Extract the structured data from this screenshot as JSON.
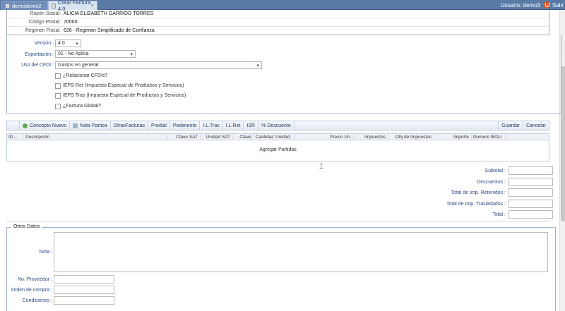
{
  "tabs": [
    {
      "label": "demodemo2"
    },
    {
      "label": "Crear Factura 4.0",
      "close": "×"
    }
  ],
  "user": {
    "label": "Usuario: demo3",
    "logout": "Salir"
  },
  "emisor": {
    "razon_social_label": "Razón Social:",
    "razon_social": "ALICIA ELIZABETH GARRIDO TORRES",
    "codigo_postal_label": "Código Postal:",
    "codigo_postal": "70000",
    "regimen_label": "Regimen Fiscal:",
    "regimen": "626 - Regimen Simplificado de Confianza"
  },
  "form": {
    "version_label": "Versión :",
    "version_value": "4.0",
    "exportacion_label": "Exportación :",
    "exportacion_value": "01 - No Aplica",
    "uso_cfdi_label": "Uso del CFDI :",
    "uso_cfdi_value": "Gastos en general",
    "checks": [
      "¿Relacionar CFDIs?",
      "IEPS Ret (Impuesto Especial de Productos y Servicios)",
      "IEPS Tras (Impuesto Especial de Productos y Servicios)",
      "¿Factura Global?"
    ]
  },
  "toolbar": {
    "concepto_nuevo": "Concepto Nuevo",
    "nota_partica": "Nota Partica",
    "otras_facturas": "OtrasFacturas",
    "predial": "Predial",
    "pedimento": "Pedimento",
    "il_tras": "I.L.Tras",
    "il_ret": "I.L.Ret",
    "isr": "ISR",
    "descuento": "% Descuento",
    "guardar": "Guardar",
    "cancelar": "Cancelar"
  },
  "grid": {
    "headers": [
      "ID...",
      "Descripción",
      "Clave SAT",
      "Unidad SAT",
      "Clave",
      "Cantidad",
      "Unidad",
      "Precio Un...",
      "Impuestos",
      "Obj de Impuestos",
      "Importe",
      "Numero IEDU"
    ],
    "empty_text": "Agregar Partidas"
  },
  "totals": {
    "subtotal": "Subtotal :",
    "descuentos": "Descuentos :",
    "ret": "Total de Imp. Retenidos :",
    "tras": "Total de Imp. Trasladados :",
    "total": "Total :"
  },
  "otros": {
    "legend": "Otros Datos",
    "nota": "Nota :",
    "no_proveedor": "No. Proveedor :",
    "orden_compra": "Orden de compra :",
    "condiciones": "Condiciones :"
  }
}
